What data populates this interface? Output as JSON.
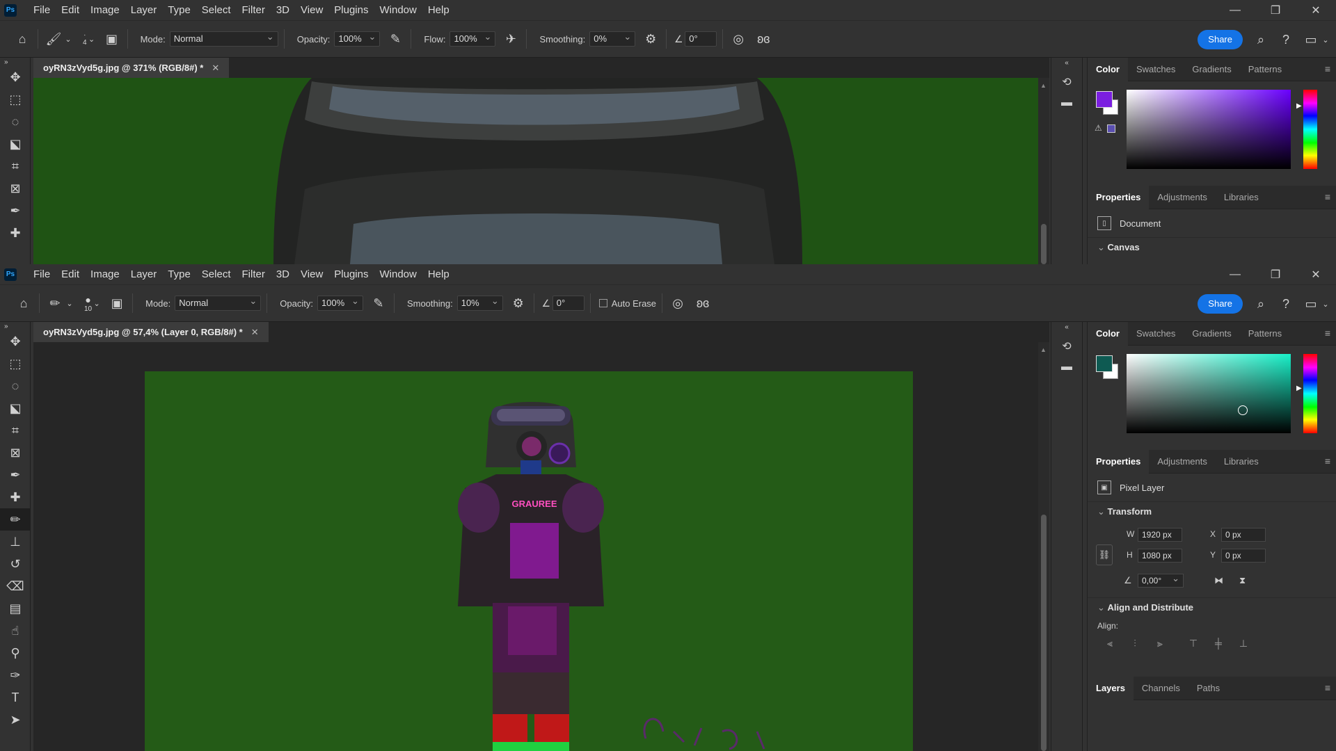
{
  "menu": [
    "File",
    "Edit",
    "Image",
    "Layer",
    "Type",
    "Select",
    "Filter",
    "3D",
    "View",
    "Plugins",
    "Window",
    "Help"
  ],
  "app_logo": "Ps",
  "window_controls": {
    "minimize": "—",
    "restore": "❐",
    "close": "✕"
  },
  "top_window": {
    "options": {
      "brush_size": "4",
      "mode_label": "Mode:",
      "mode_value": "Normal",
      "opacity_label": "Opacity:",
      "opacity_value": "100%",
      "flow_label": "Flow:",
      "flow_value": "100%",
      "smoothing_label": "Smoothing:",
      "smoothing_value": "0%",
      "angle_value": "0°",
      "share_label": "Share"
    },
    "doc_tab": "oyRN3zVyd5g.jpg @ 371% (RGB/8#) *",
    "color_tabs": [
      "Color",
      "Swatches",
      "Gradients",
      "Patterns"
    ],
    "properties_tabs": [
      "Properties",
      "Adjustments",
      "Libraries"
    ],
    "properties_kind": "Document",
    "next_section": "Canvas",
    "fg_color": "#7b1fe0",
    "field_hue": "#6a00ff"
  },
  "bottom_window": {
    "options": {
      "brush_size": "10",
      "mode_label": "Mode:",
      "mode_value": "Normal",
      "opacity_label": "Opacity:",
      "opacity_value": "100%",
      "smoothing_label": "Smoothing:",
      "smoothing_value": "10%",
      "angle_value": "0°",
      "auto_erase_label": "Auto Erase",
      "share_label": "Share"
    },
    "doc_tab": "oyRN3zVyd5g.jpg @ 57,4% (Layer 0, RGB/8#) *",
    "color_tabs": [
      "Color",
      "Swatches",
      "Gradients",
      "Patterns"
    ],
    "properties_tabs": [
      "Properties",
      "Adjustments",
      "Libraries"
    ],
    "properties_kind": "Pixel Layer",
    "transform": {
      "title": "Transform",
      "w_label": "W",
      "w_value": "1920 px",
      "h_label": "H",
      "h_value": "1080 px",
      "x_label": "X",
      "x_value": "0 px",
      "y_label": "Y",
      "y_value": "0 px",
      "angle_value": "0,00°"
    },
    "align": {
      "title": "Align and Distribute",
      "label": "Align:"
    },
    "layers_tabs": [
      "Layers",
      "Channels",
      "Paths"
    ],
    "fg_color": "#0e5a52",
    "field_hue": "#18f0c8",
    "artwork": {
      "chest_text": "GRAUREE"
    }
  }
}
